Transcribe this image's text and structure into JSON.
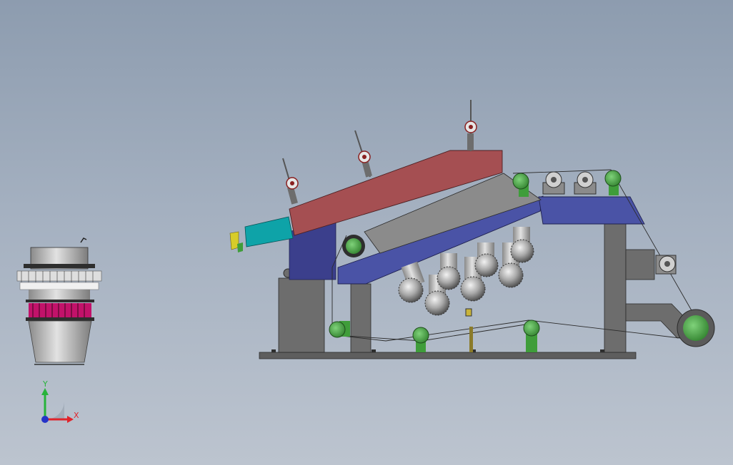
{
  "triad": {
    "x_label": "X",
    "y_label": "Y",
    "x_color": "#e0242b",
    "y_color": "#27b33a",
    "z_color": "#2533c8"
  },
  "colors": {
    "background_top": "#8d9caf",
    "background_bottom": "#bcc4cf",
    "hood": "#a54f52",
    "frame_blue": "#4a53a6",
    "steel_grey": "#6d6d6d",
    "roller_green": "#3f9d3a",
    "inlet_teal": "#0ea3a8",
    "magenta_band": "#c2126a"
  }
}
